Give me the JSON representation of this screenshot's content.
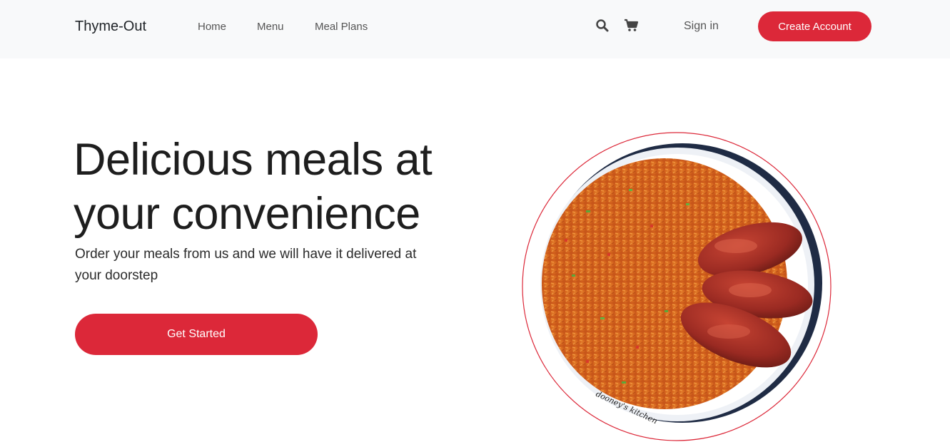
{
  "navbar": {
    "brand": "Thyme-Out",
    "links": [
      "Home",
      "Menu",
      "Meal Plans"
    ],
    "icons": [
      "search-icon",
      "cart-icon"
    ],
    "signin": "Sign in",
    "create_account": "Create Account"
  },
  "hero": {
    "title": "Delicious meals at your convenience",
    "subtitle": "Order your meals from us and we will have it delivered at your doorstep",
    "cta": "Get Started"
  },
  "image": {
    "watermark": "dooney's kitchen"
  },
  "colors": {
    "accent": "#dc2839",
    "navbar_bg": "#f8f9fa",
    "text": "#212529"
  }
}
